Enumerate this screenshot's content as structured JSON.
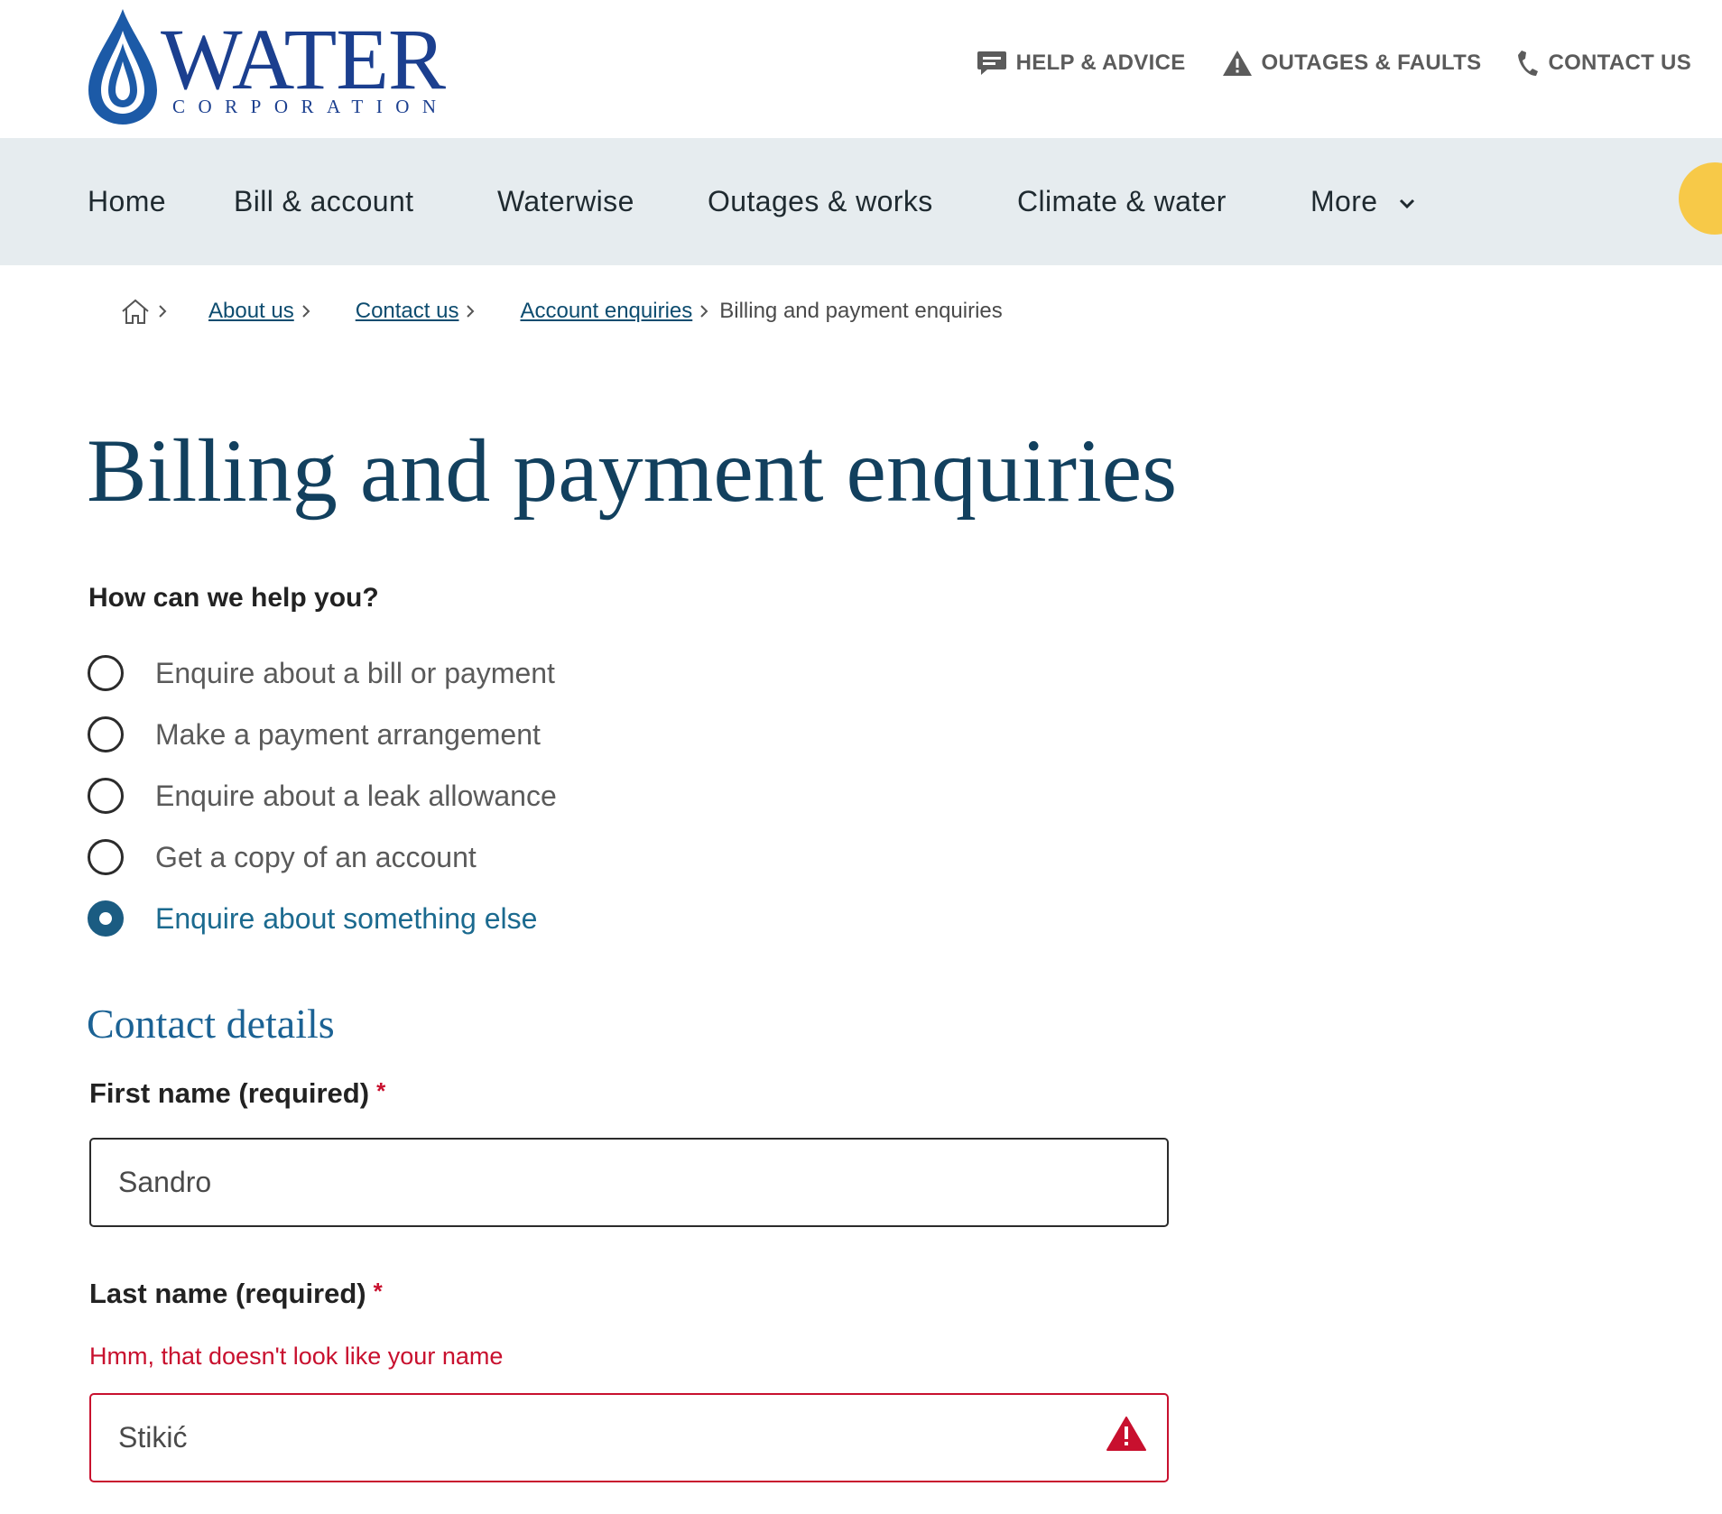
{
  "brand": {
    "word": "WATER",
    "sub": "CORPORATION",
    "primary_color": "#1b3f8f",
    "drop_color": "#1c5aa7"
  },
  "utility_nav": [
    {
      "label": "HELP & ADVICE",
      "icon": "chat-icon"
    },
    {
      "label": "OUTAGES & FAULTS",
      "icon": "warning-icon"
    },
    {
      "label": "CONTACT US",
      "icon": "phone-icon"
    }
  ],
  "main_nav": {
    "items": [
      "Home",
      "Bill & account",
      "Waterwise",
      "Outages & works",
      "Climate & water"
    ],
    "more": "More"
  },
  "breadcrumb": {
    "home_icon": "home-icon",
    "links": [
      "About us",
      "Contact us",
      "Account enquiries"
    ],
    "current": "Billing and payment enquiries"
  },
  "page": {
    "title": "Billing and payment enquiries",
    "question": "How can we help you?",
    "options": [
      {
        "label": "Enquire about a bill or payment",
        "selected": false
      },
      {
        "label": "Make a payment arrangement",
        "selected": false
      },
      {
        "label": "Enquire about a leak allowance",
        "selected": false
      },
      {
        "label": "Get a copy of an account",
        "selected": false
      },
      {
        "label": "Enquire about something else",
        "selected": true
      }
    ]
  },
  "contact": {
    "section_title": "Contact details",
    "first_name": {
      "label": "First name (required)",
      "required_mark": "*",
      "value": "Sandro"
    },
    "last_name": {
      "label": "Last name (required)",
      "required_mark": "*",
      "error": "Hmm, that doesn't look like your name",
      "value": "Stikić",
      "error_icon": "warning-icon"
    }
  },
  "colors": {
    "accent": "#1b5c82",
    "error": "#c8102e",
    "nav_bg": "#e6ecef",
    "title": "#12405e"
  }
}
